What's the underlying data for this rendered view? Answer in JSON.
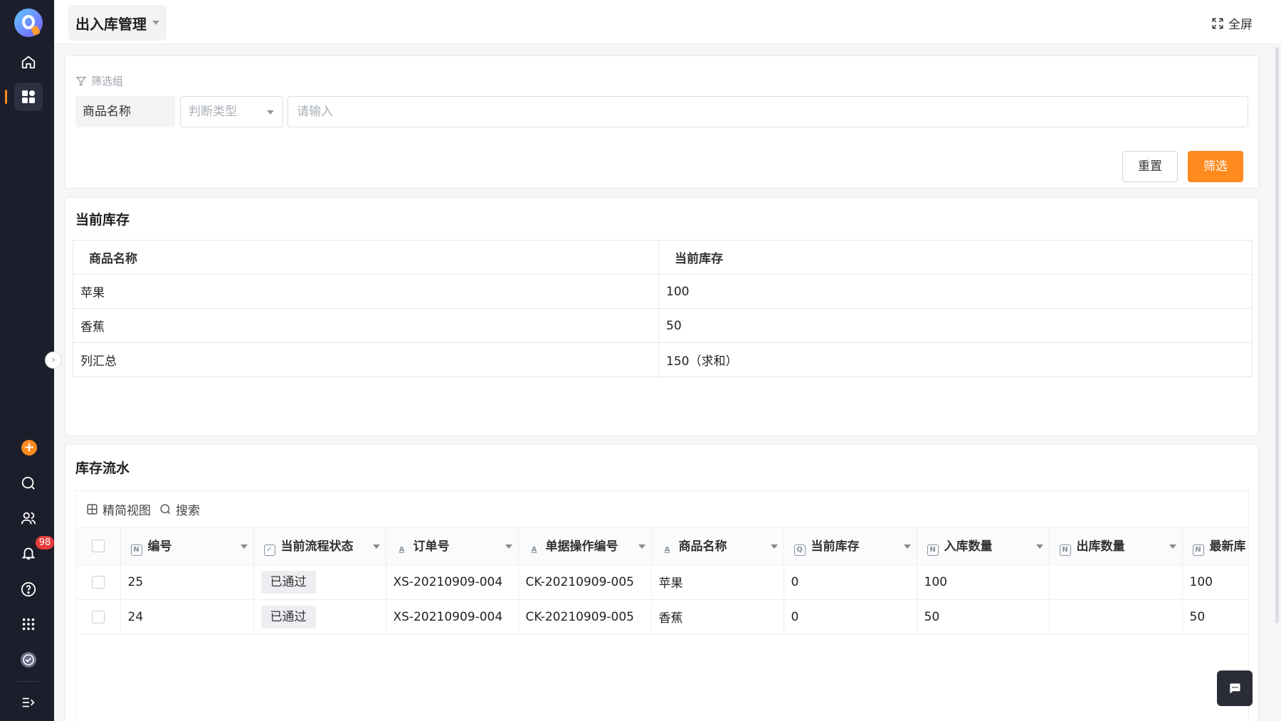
{
  "header": {
    "page_title": "出入库管理",
    "fullscreen_label": "全屏"
  },
  "sidebar": {
    "notification_count": "98",
    "items": [
      "logo",
      "home-icon",
      "apps-grid-icon",
      "add-icon",
      "search-icon",
      "users-icon",
      "bell-icon",
      "help-icon",
      "app-menu-icon",
      "check-circle-icon",
      "expand-icon"
    ],
    "accent_color": "#ff8a1f"
  },
  "filter": {
    "group_label": "筛选组",
    "field_label": "商品名称",
    "type_placeholder": "判断类型",
    "input_placeholder": "请输入",
    "reset_label": "重置",
    "submit_label": "筛选"
  },
  "stock": {
    "title": "当前库存",
    "columns": [
      "商品名称",
      "当前库存"
    ],
    "rows": [
      [
        "苹果",
        "100"
      ],
      [
        "香蕉",
        "50"
      ],
      [
        "列汇总",
        "150（求和）"
      ]
    ]
  },
  "flow": {
    "title": "库存流水",
    "toolbar": {
      "view_label": "精简视图",
      "search_label": "搜索"
    },
    "columns": [
      {
        "label": "编号",
        "icon": "N"
      },
      {
        "label": "当前流程状态",
        "icon": "check"
      },
      {
        "label": "订单号",
        "icon": "A"
      },
      {
        "label": "单据操作编号",
        "icon": "A"
      },
      {
        "label": "商品名称",
        "icon": "A"
      },
      {
        "label": "当前库存",
        "icon": "Q"
      },
      {
        "label": "入库数量",
        "icon": "N"
      },
      {
        "label": "出库数量",
        "icon": "N"
      },
      {
        "label": "最新库",
        "icon": "N"
      }
    ],
    "rows": [
      {
        "id": "25",
        "status": "已通过",
        "order": "XS-20210909-004",
        "doc": "CK-20210909-005",
        "name": "苹果",
        "stock": "0",
        "in": "100",
        "out": "",
        "latest": "100"
      },
      {
        "id": "24",
        "status": "已通过",
        "order": "XS-20210909-004",
        "doc": "CK-20210909-005",
        "name": "香蕉",
        "stock": "0",
        "in": "50",
        "out": "",
        "latest": "50"
      }
    ]
  }
}
